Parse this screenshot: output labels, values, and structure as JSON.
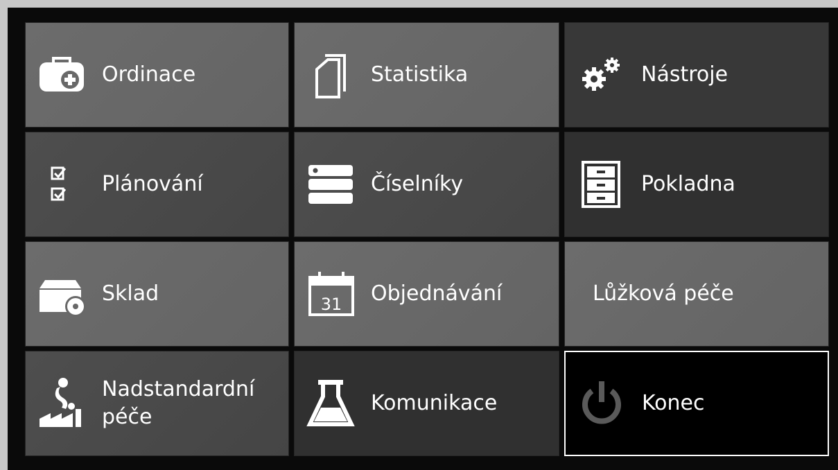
{
  "tiles": [
    {
      "label": "Ordinace",
      "icon": "medical-case-icon"
    },
    {
      "label": "Statistika",
      "icon": "documents-icon"
    },
    {
      "label": "Nástroje",
      "icon": "gears-icon"
    },
    {
      "label": "Plánování",
      "icon": "checklist-icon"
    },
    {
      "label": "Číselníky",
      "icon": "server-stack-icon"
    },
    {
      "label": "Pokladna",
      "icon": "cabinet-drawers-icon"
    },
    {
      "label": "Sklad",
      "icon": "box-disc-icon"
    },
    {
      "label": "Objednávání",
      "icon": "calendar-icon",
      "calendar_day": "31"
    },
    {
      "label": "Lůžková péče",
      "icon": ""
    },
    {
      "label_line1": "Nadstandardní",
      "label_line2": "péče",
      "icon": "factory-icon"
    },
    {
      "label": "Komunikace",
      "icon": "flask-icon"
    },
    {
      "label": "Konec",
      "icon": "power-icon"
    }
  ],
  "colors": {
    "background": "#0a0a0a",
    "tile_light": "#686868",
    "tile_dark": "#383838",
    "exit_tile": "#000000",
    "power_icon": "#5a5a5a"
  }
}
